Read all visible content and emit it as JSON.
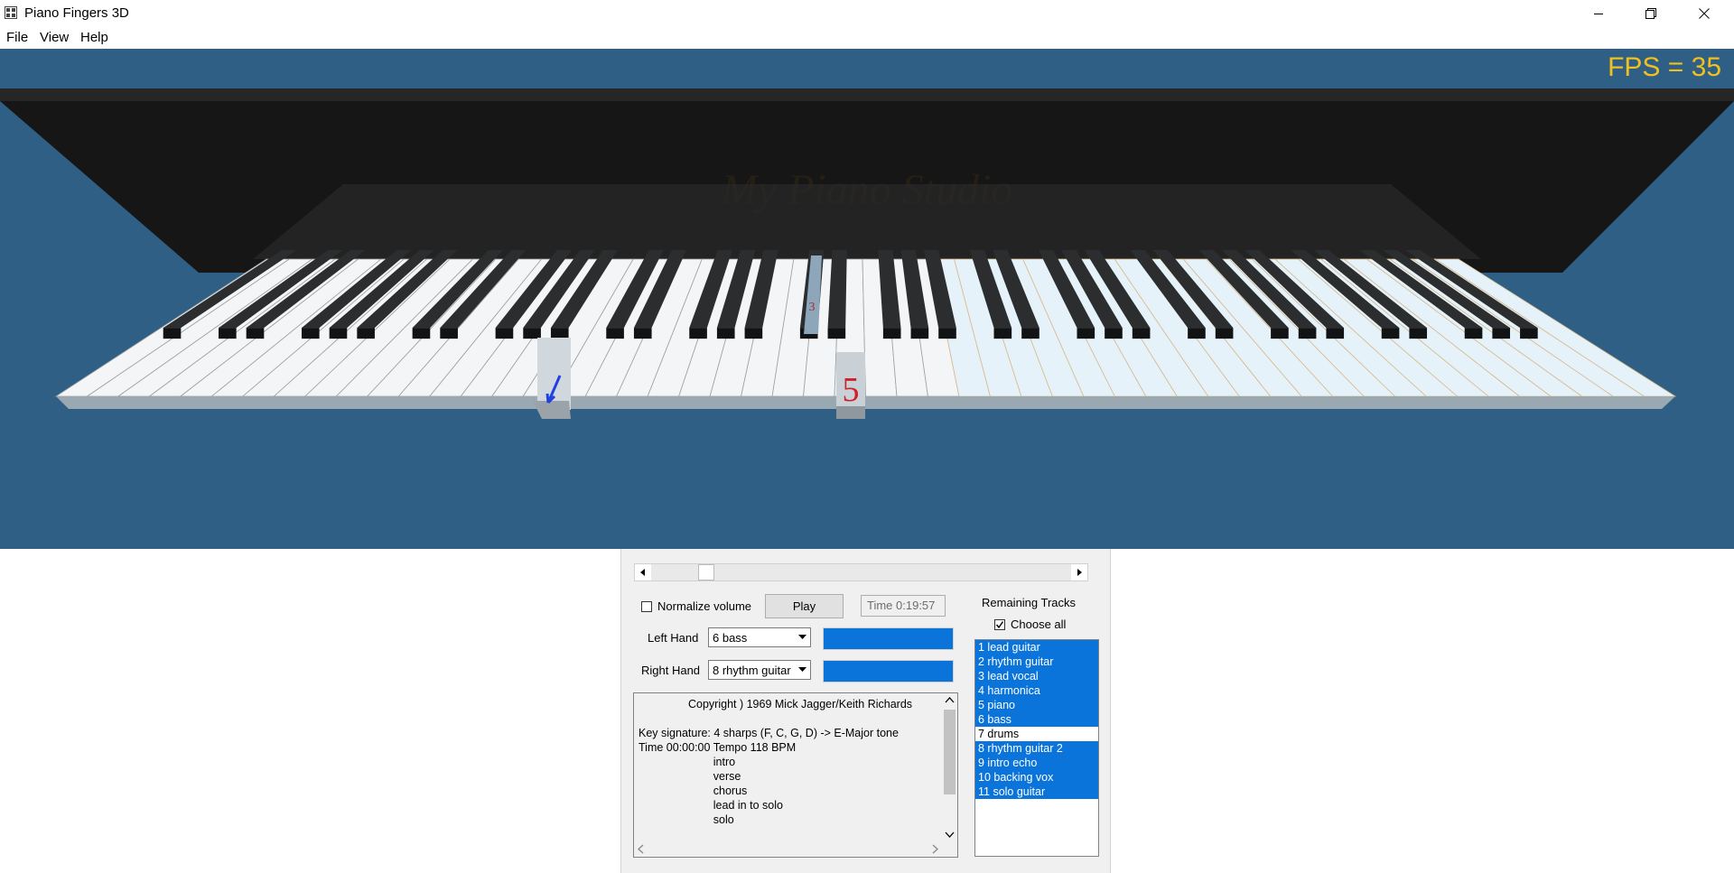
{
  "window": {
    "title": "Piano Fingers 3D",
    "icon": "app-grid-icon",
    "controls": [
      "minimize-icon",
      "restore-icon",
      "close-icon"
    ]
  },
  "menu": {
    "file": "File",
    "view": "View",
    "help": "Help"
  },
  "viewport": {
    "fps_label": "FPS = 35",
    "background": "#2f5f84",
    "lid_text": "My Piano Studio",
    "finger_numbers": {
      "pressed_white": "5",
      "pressed_black": "3"
    },
    "colors": {
      "fps": "#f0c020",
      "finger_number": "#d0202a",
      "pressed_arrow": "#2040e0"
    }
  },
  "panel": {
    "normalize_label": "Normalize volume",
    "normalize_checked": false,
    "play_label": "Play",
    "time_text": "Time 0:19:57",
    "left_hand_label": "Left Hand",
    "left_hand_value": "6 bass",
    "right_hand_label": "Right Hand",
    "right_hand_value": "8 rhythm guitar",
    "remaining_tracks_label": "Remaining Tracks",
    "choose_all_label": "Choose all",
    "choose_all_checked": true,
    "accent": "#0a74da",
    "info_lines": [
      "Copyright ) 1969 Mick Jagger/Keith Richards",
      "",
      "Key signature: 4 sharps (F, C, G, D) -> E-Major tone",
      "Time 00:00:00 Tempo 118 BPM",
      "        intro",
      "        verse",
      "        chorus",
      "        lead in to solo",
      "        solo"
    ],
    "tracks": [
      {
        "label": "1 lead guitar",
        "selected": true
      },
      {
        "label": "2 rhythm guitar",
        "selected": true
      },
      {
        "label": "3 lead vocal",
        "selected": true
      },
      {
        "label": "4 harmonica",
        "selected": true
      },
      {
        "label": "5 piano",
        "selected": true
      },
      {
        "label": "6 bass",
        "selected": true
      },
      {
        "label": "7 drums",
        "selected": false
      },
      {
        "label": "8 rhythm guitar 2",
        "selected": true
      },
      {
        "label": "9 intro echo",
        "selected": true
      },
      {
        "label": "10 backing vox",
        "selected": true
      },
      {
        "label": "11 solo guitar",
        "selected": true
      }
    ]
  }
}
